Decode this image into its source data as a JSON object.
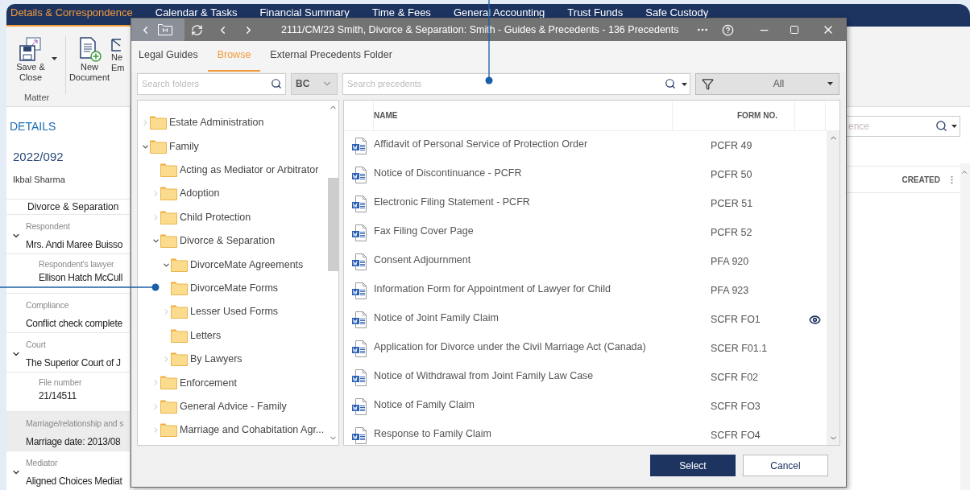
{
  "app_tabs": [
    {
      "label": "Details & Correspondence",
      "selected": true
    },
    {
      "label": "Calendar & Tasks",
      "selected": false
    },
    {
      "label": "Financial Summary",
      "selected": false
    },
    {
      "label": "Time & Fees",
      "selected": false
    },
    {
      "label": "General Accounting",
      "selected": false
    },
    {
      "label": "Trust Funds",
      "selected": false
    },
    {
      "label": "Safe Custody",
      "selected": false
    }
  ],
  "ribbon": {
    "buttons": [
      {
        "kind": "save",
        "lines": [
          "Save &",
          "Close"
        ],
        "has_menu": true
      },
      {
        "kind": "new-document",
        "lines": [
          "New",
          "Document"
        ],
        "has_menu": false
      },
      {
        "kind": "email",
        "lines": [
          "Ne",
          "Em"
        ],
        "has_menu": false
      }
    ],
    "group_label": "Matter"
  },
  "details": {
    "heading": "DETAILS",
    "matter_number": "2022/092",
    "client": "Ikbal Sharma",
    "matter_type": "Divorce & Separation",
    "fields": [
      {
        "label": "Respondent",
        "value": "Mrs. Andi Maree Buisso",
        "expanded": true,
        "highlighted": false,
        "children": [
          {
            "label": "Respondent's lawyer",
            "value": "Ellison Hatch McCull"
          }
        ]
      },
      {
        "label": "Compliance",
        "value": "Conflict check complete",
        "highlighted": false
      },
      {
        "label": "Court",
        "value": "The Superior Court of J",
        "expanded": true,
        "highlighted": false,
        "children": [
          {
            "label": "File number",
            "value": "21/14511"
          }
        ]
      },
      {
        "label": "Marriage/relationship and s",
        "value": "Marriage date: 2013/08",
        "highlighted": true
      },
      {
        "label": "Mediator",
        "value": "Aligned Choices Mediat",
        "expanded": true,
        "highlighted": false
      }
    ]
  },
  "right_panel": {
    "search": {
      "placeholder": "ence"
    },
    "column": "CREATED"
  },
  "dialog": {
    "title": "2111/CM/23 Smith, Divorce & Separation: Smith - Guides & Precedents - 136 Precedents",
    "tabs": [
      {
        "label": "Legal Guides",
        "selected": false
      },
      {
        "label": "Browse",
        "selected": true
      },
      {
        "label": "External Precedents Folder",
        "selected": false
      }
    ],
    "folder_search": {
      "placeholder": "Search folders"
    },
    "region": {
      "value": "BC"
    },
    "precedent_search": {
      "placeholder": "Search precedents"
    },
    "filter": {
      "value": "All"
    },
    "tree": [
      {
        "label": "Estate Administration",
        "expanded": false
      },
      {
        "label": "Family",
        "expanded": true,
        "children": [
          {
            "label": "Acting as Mediator or Arbitrator"
          },
          {
            "label": "Adoption",
            "expanded": false
          },
          {
            "label": "Child Protection",
            "expanded": false
          },
          {
            "label": "Divorce & Separation",
            "expanded": true,
            "children": [
              {
                "label": "DivorceMate Agreements",
                "expanded": true
              },
              {
                "label": "DivorceMate Forms"
              },
              {
                "label": "Lesser Used Forms",
                "expanded": false
              },
              {
                "label": "Letters"
              },
              {
                "label": "By Lawyers",
                "expanded": false
              }
            ]
          },
          {
            "label": "Enforcement",
            "expanded": false
          },
          {
            "label": "General Advice - Family",
            "expanded": false
          },
          {
            "label": "Marriage and Cohabitation Agr...",
            "expanded": false
          }
        ]
      }
    ],
    "columns": [
      "NAME",
      "FORM NO."
    ],
    "rows": [
      {
        "name": "Affidavit of Personal Service of Protection Order",
        "form_no": "PCFR 49",
        "preview": false
      },
      {
        "name": "Notice of Discontinuance - PCFR",
        "form_no": "PCFR 50",
        "preview": false
      },
      {
        "name": "Electronic Filing Statement - PCFR",
        "form_no": "PCER 51",
        "preview": false
      },
      {
        "name": "Fax Filing Cover Page",
        "form_no": "PCFR 52",
        "preview": false
      },
      {
        "name": "Consent Adjournment",
        "form_no": "PFA 920",
        "preview": false
      },
      {
        "name": "Information Form for Appointment of Lawyer for Child",
        "form_no": "PFA 923",
        "preview": false
      },
      {
        "name": "Notice of Joint Family Claim",
        "form_no": "SCFR FO1",
        "preview": true
      },
      {
        "name": "Application for Divorce under the Civil Marriage Act (Canada)",
        "form_no": "SCER F01.1",
        "preview": false
      },
      {
        "name": "Notice of Withdrawal from Joint Family Law Case",
        "form_no": "SCFR F02",
        "preview": false
      },
      {
        "name": "Notice of Family Claim",
        "form_no": "SCFR FO3",
        "preview": false
      },
      {
        "name": "Response to Family Claim",
        "form_no": "SCFR FO4",
        "preview": false
      }
    ],
    "buttons": [
      {
        "label": "Select",
        "kind": "primary"
      },
      {
        "label": "Cancel",
        "kind": "secondary"
      }
    ]
  }
}
